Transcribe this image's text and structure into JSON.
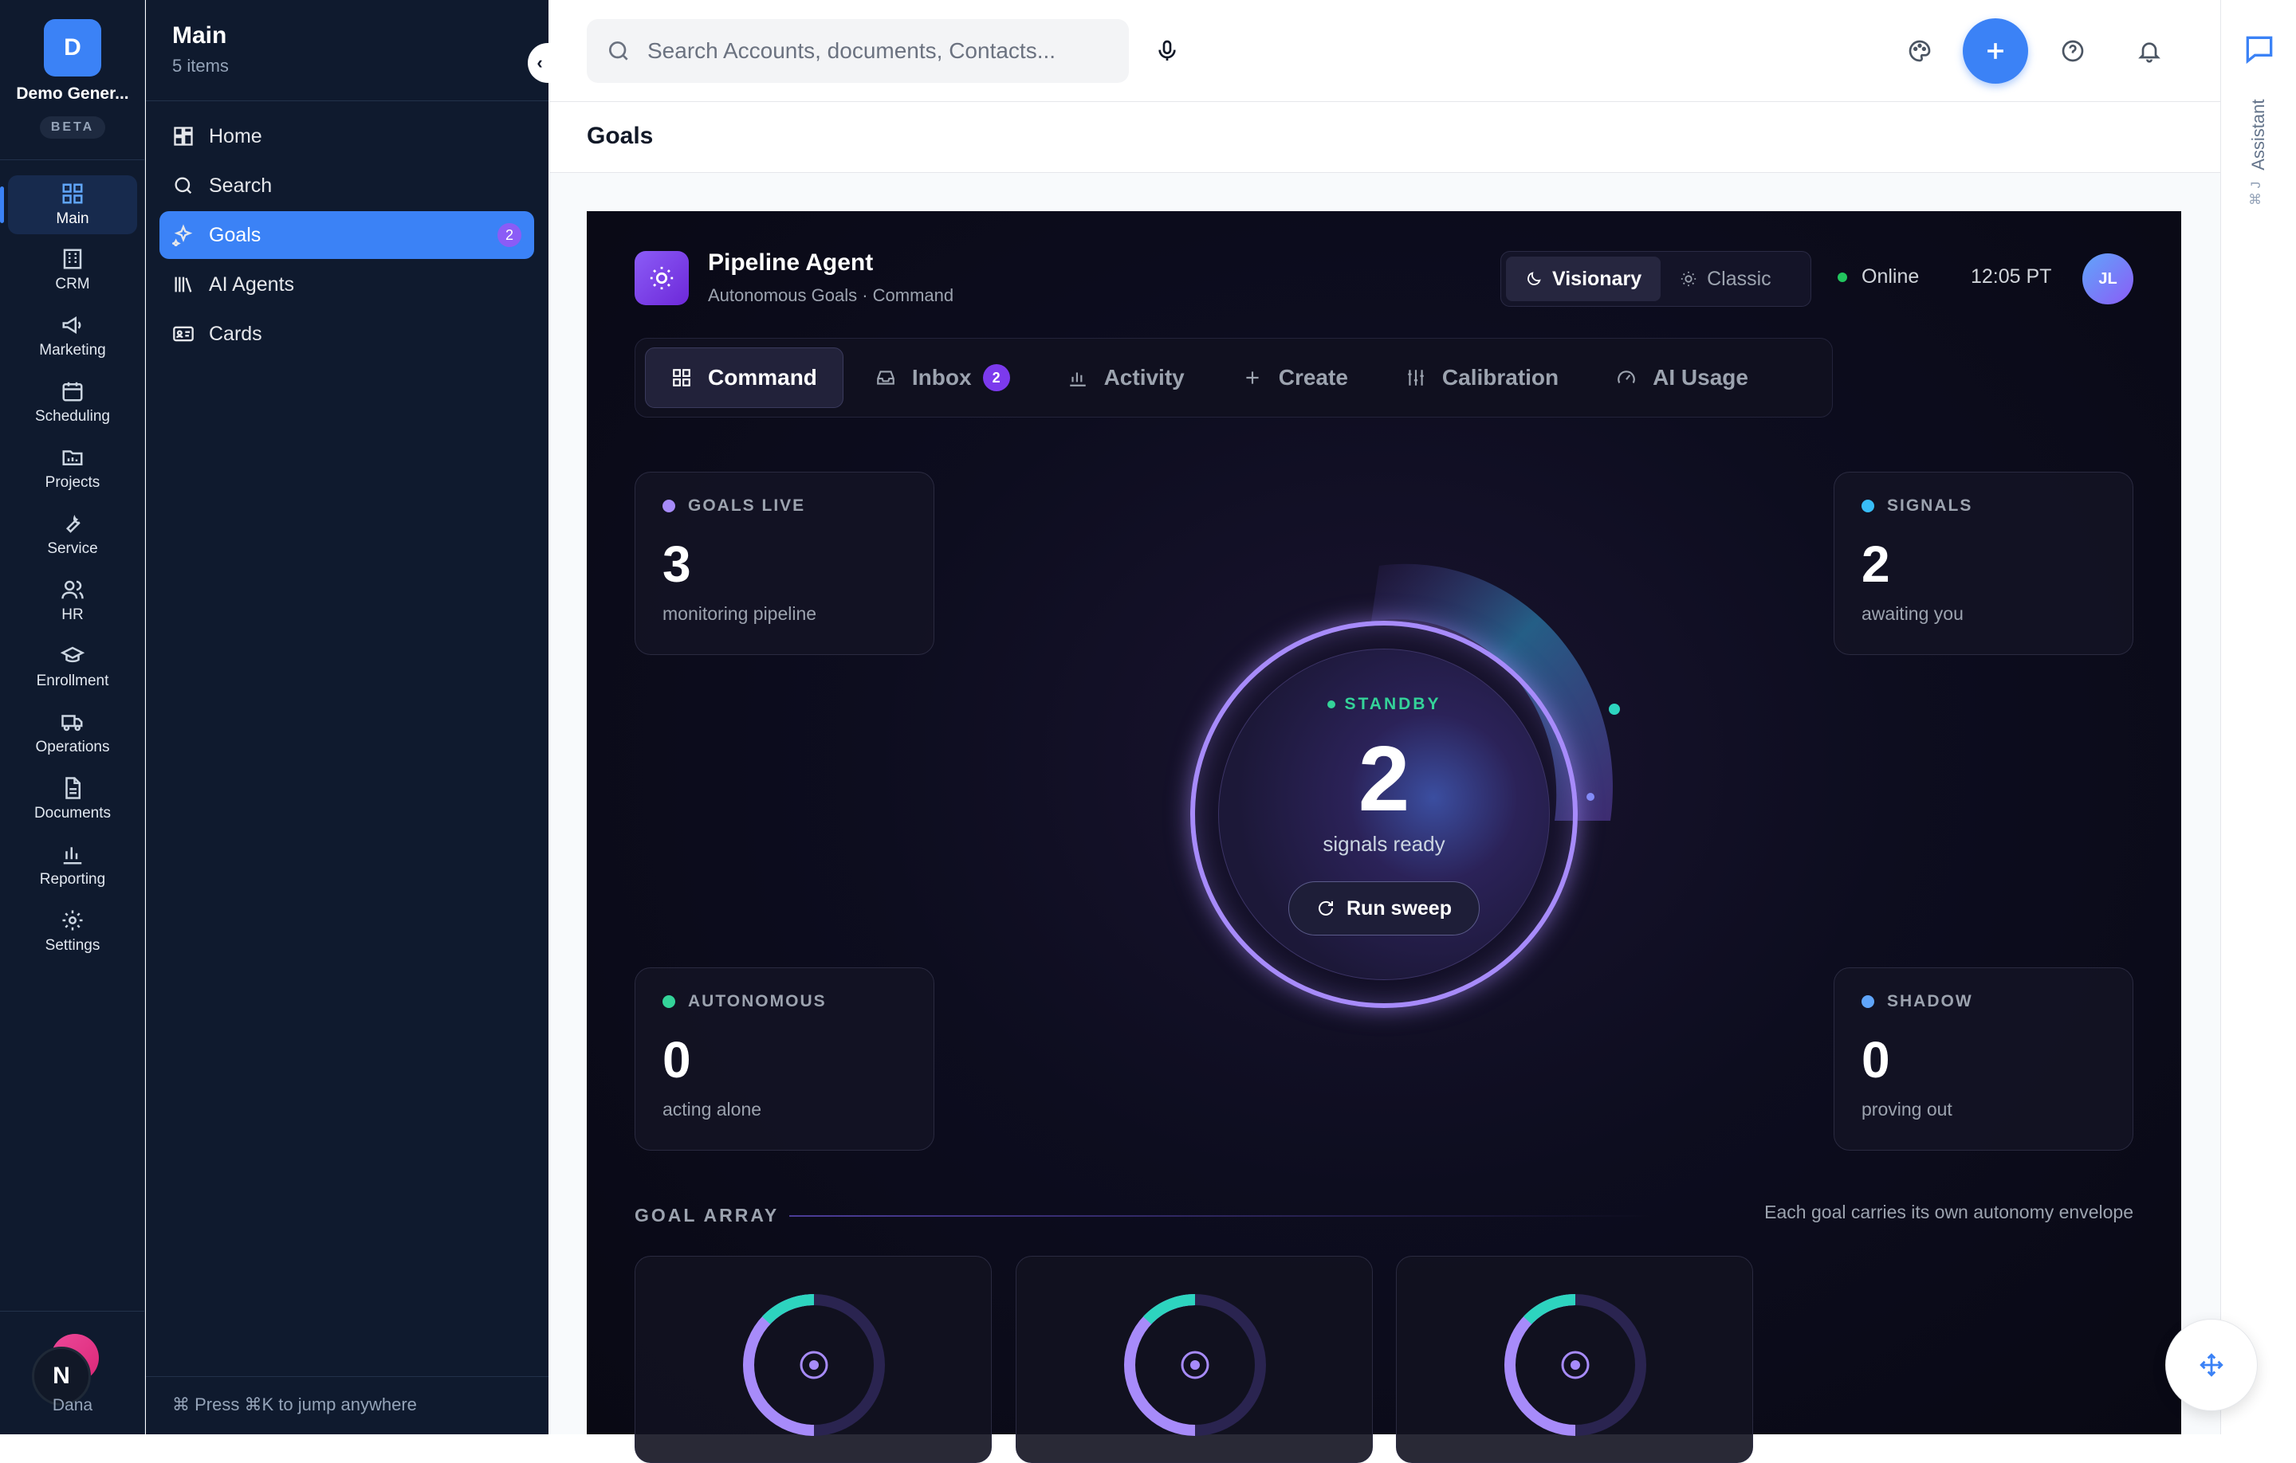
{
  "org": {
    "initial": "D",
    "name": "Demo General",
    "name_display": "Demo Gener...",
    "tag": "BETA"
  },
  "rail": {
    "items": [
      {
        "label": "Main",
        "icon": "grid-icon"
      },
      {
        "label": "CRM",
        "icon": "building-icon"
      },
      {
        "label": "Marketing",
        "icon": "megaphone-icon"
      },
      {
        "label": "Scheduling",
        "icon": "calendar-icon"
      },
      {
        "label": "Projects",
        "icon": "folder-icon"
      },
      {
        "label": "Service",
        "icon": "wrench-icon"
      },
      {
        "label": "HR",
        "icon": "users-icon"
      },
      {
        "label": "Enrollment",
        "icon": "graduation-cap-icon"
      },
      {
        "label": "Operations",
        "icon": "truck-icon"
      },
      {
        "label": "Documents",
        "icon": "document-icon"
      },
      {
        "label": "Reporting",
        "icon": "bar-chart-icon"
      },
      {
        "label": "Settings",
        "icon": "gear-icon"
      }
    ],
    "user": {
      "initial": "N",
      "name": "Dana"
    }
  },
  "panel": {
    "title": "Main",
    "subtitle": "5 items",
    "items": [
      {
        "label": "Home",
        "icon": "layout-icon"
      },
      {
        "label": "Search",
        "icon": "search-icon"
      },
      {
        "label": "Goals",
        "icon": "sparkles-icon",
        "badge": "2"
      },
      {
        "label": "AI Agents",
        "icon": "library-icon"
      },
      {
        "label": "Cards",
        "icon": "id-card-icon"
      }
    ],
    "footer": "⌘ Press ⌘K to jump anywhere"
  },
  "topbar": {
    "search_placeholder": "Search Accounts, documents, Contacts..."
  },
  "page": {
    "heading": "Goals"
  },
  "assistant": {
    "label": "Assistant",
    "shortcut": "⌘ J"
  },
  "agent": {
    "name": "Pipeline Agent",
    "subtitle": "Autonomous Goals · Command",
    "modes": [
      "Visionary",
      "Classic"
    ],
    "status": "Online",
    "time": "12:05 PT",
    "user_initials": "JL"
  },
  "tabs": [
    {
      "label": "Command",
      "icon": "grid-icon"
    },
    {
      "label": "Inbox",
      "icon": "inbox-icon",
      "count": "2"
    },
    {
      "label": "Activity",
      "icon": "bar-chart-icon"
    },
    {
      "label": "Create",
      "icon": "plus-icon"
    },
    {
      "label": "Calibration",
      "icon": "sliders-icon"
    },
    {
      "label": "AI Usage",
      "icon": "gauge-icon"
    }
  ],
  "stats": {
    "goals_live": {
      "label": "GOALS LIVE",
      "value": "3",
      "caption": "monitoring pipeline",
      "color": "#a78bfa"
    },
    "signals": {
      "label": "SIGNALS",
      "value": "2",
      "caption": "awaiting you",
      "color": "#38bdf8"
    },
    "autonomous": {
      "label": "AUTONOMOUS",
      "value": "0",
      "caption": "acting alone",
      "color": "#34d399"
    },
    "shadow": {
      "label": "SHADOW",
      "value": "0",
      "caption": "proving out",
      "color": "#60a5fa"
    }
  },
  "orb": {
    "status": "STANDBY",
    "value": "2",
    "caption": "signals ready",
    "button": "Run sweep"
  },
  "goal_array": {
    "label": "GOAL ARRAY",
    "note": "Each goal carries its own autonomy envelope"
  },
  "colors": {
    "accent": "#3b82f6",
    "violet": "#8b5cf6",
    "teal": "#2dd4bf"
  }
}
